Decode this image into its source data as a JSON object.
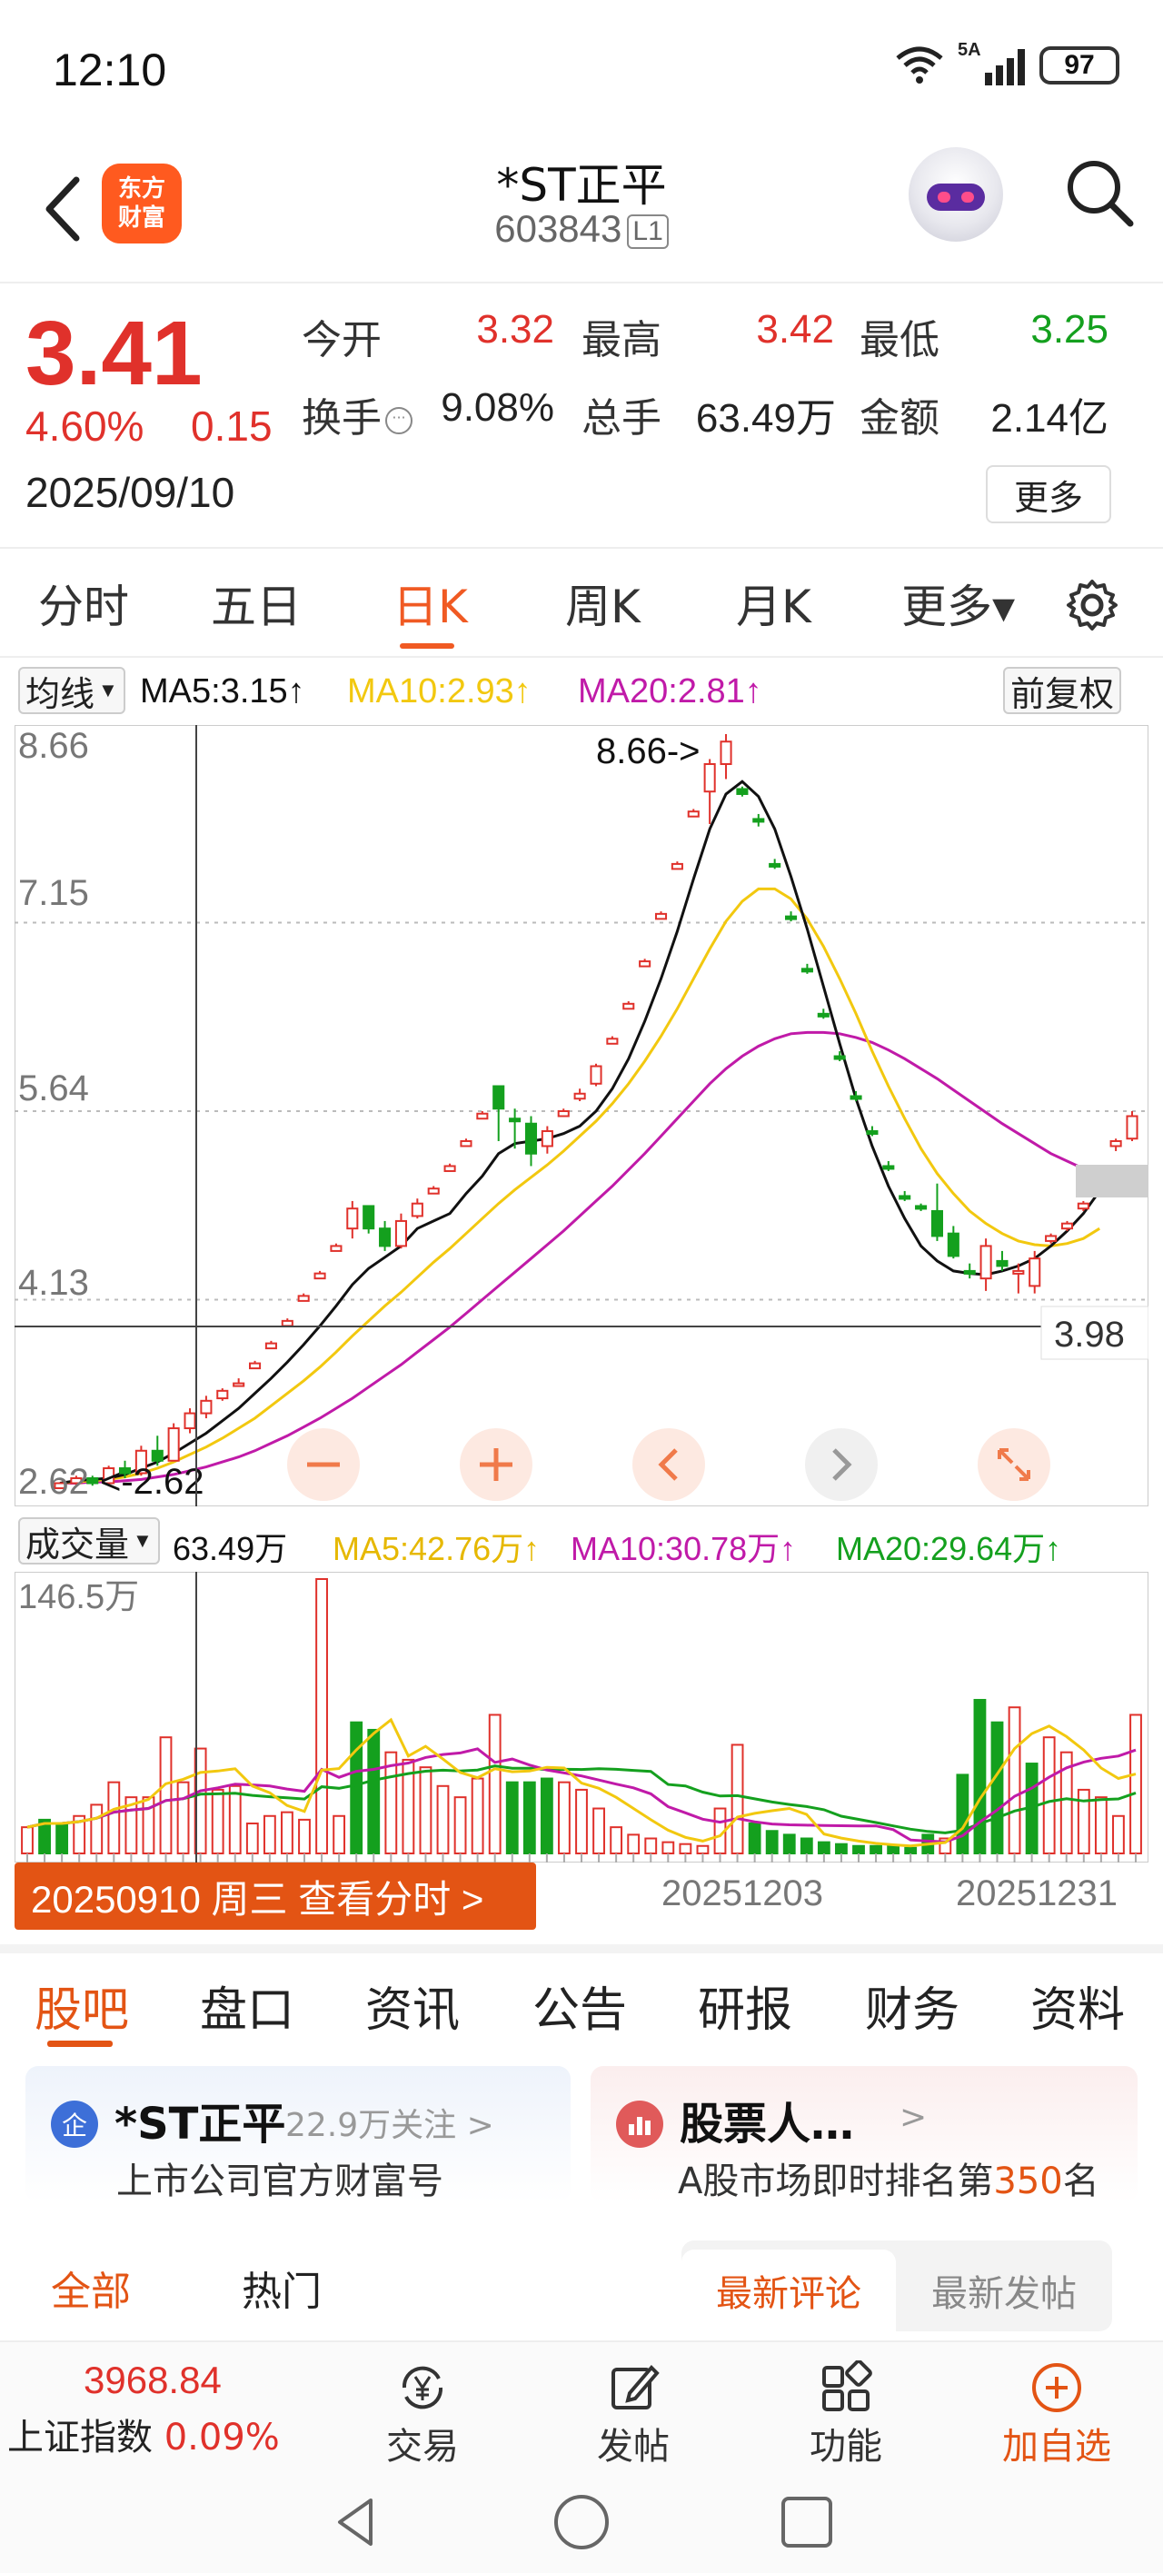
{
  "status_bar": {
    "time": "12:10",
    "network": "5A",
    "battery": "97"
  },
  "header": {
    "logo_text_line1": "东方",
    "logo_text_line2": "财富",
    "stock_name": "*ST正平",
    "stock_code": "603843",
    "market_level": "L1"
  },
  "quote": {
    "price": "3.41",
    "change_pct": "4.60%",
    "change_amt": "0.15",
    "date": "2025/09/10",
    "open_label": "今开",
    "open_value": "3.32",
    "high_label": "最高",
    "high_value": "3.42",
    "low_label": "最低",
    "low_value": "3.25",
    "turnover_label": "换手",
    "turnover_value": "9.08%",
    "volume_label": "总手",
    "volume_value": "63.49万",
    "amount_label": "金额",
    "amount_value": "2.14亿",
    "more_label": "更多"
  },
  "period_tabs": [
    {
      "label": "分时",
      "active": false
    },
    {
      "label": "五日",
      "active": false
    },
    {
      "label": "日K",
      "active": true
    },
    {
      "label": "周K",
      "active": false
    },
    {
      "label": "月K",
      "active": false
    },
    {
      "label": "更多▾",
      "active": false
    }
  ],
  "ma_legend": {
    "selector": "均线",
    "ma5": "MA5:3.15↑",
    "ma10": "MA10:2.93↑",
    "ma20": "MA20:2.81↑",
    "adjust": "前复权"
  },
  "kline": {
    "y_ticks": [
      "8.66",
      "7.15",
      "5.64",
      "4.13",
      "2.62"
    ],
    "max_label": "8.66->",
    "min_label": "<-2.62",
    "crosshair_value": "3.98",
    "controls": [
      "zoom-out",
      "zoom-in",
      "prev",
      "next",
      "fullscreen"
    ]
  },
  "volume_legend": {
    "selector": "成交量",
    "vol": "63.49万",
    "ma5": "MA5:42.76万↑",
    "ma10": "MA10:30.78万↑",
    "ma20": "MA20:29.64万↑",
    "y_max": "146.5万"
  },
  "date_badge": "20250910 周三 查看分时 >",
  "x_dates": [
    "20251203",
    "20251231"
  ],
  "content_tabs": [
    {
      "label": "股吧",
      "active": true
    },
    {
      "label": "盘口",
      "active": false
    },
    {
      "label": "资讯",
      "active": false
    },
    {
      "label": "公告",
      "active": false
    },
    {
      "label": "研报",
      "active": false
    },
    {
      "label": "财务",
      "active": false
    },
    {
      "label": "资料",
      "active": false
    }
  ],
  "cards": {
    "left": {
      "badge": "企",
      "title": "*ST正平",
      "meta": "22.9万关注 >",
      "sub": "上市公司官方财富号"
    },
    "right": {
      "title": "股票人…",
      "meta": ">",
      "sub_prefix": "A股市场即时排名第",
      "rank": "350",
      "sub_suffix": "名"
    }
  },
  "filters": {
    "all": "全部",
    "hot": "热门",
    "latest_comment": "最新评论",
    "latest_post": "最新发帖"
  },
  "bottom_bar": {
    "index_value": "3968.84",
    "index_label": "上证指数",
    "index_pct": "0.09%",
    "nav": [
      "交易",
      "发帖",
      "功能",
      "加自选"
    ]
  },
  "colors": {
    "up": "#e0312b",
    "down": "#14a01e",
    "accent": "#e35414",
    "ma5": "#111111",
    "ma10": "#f2c80f",
    "ma20": "#c01aa8"
  },
  "chart_data": {
    "type": "candlestick",
    "ylim": [
      2.62,
      8.66
    ],
    "y_ticks": [
      8.66,
      7.15,
      5.64,
      4.13,
      2.62
    ],
    "candles": [
      {
        "o": 2.62,
        "h": 2.66,
        "l": 2.62,
        "c": 2.66
      },
      {
        "o": 2.66,
        "h": 2.72,
        "l": 2.64,
        "c": 2.7
      },
      {
        "o": 2.7,
        "h": 2.72,
        "l": 2.64,
        "c": 2.66
      },
      {
        "o": 2.66,
        "h": 2.8,
        "l": 2.64,
        "c": 2.78
      },
      {
        "o": 2.78,
        "h": 2.84,
        "l": 2.7,
        "c": 2.74
      },
      {
        "o": 2.74,
        "h": 2.96,
        "l": 2.72,
        "c": 2.92
      },
      {
        "o": 2.92,
        "h": 3.04,
        "l": 2.8,
        "c": 2.84
      },
      {
        "o": 2.84,
        "h": 3.14,
        "l": 2.84,
        "c": 3.1
      },
      {
        "o": 3.1,
        "h": 3.26,
        "l": 3.06,
        "c": 3.22
      },
      {
        "o": 3.22,
        "h": 3.36,
        "l": 3.18,
        "c": 3.32
      },
      {
        "o": 3.34,
        "h": 3.42,
        "l": 3.32,
        "c": 3.4
      },
      {
        "o": 3.44,
        "h": 3.5,
        "l": 3.44,
        "c": 3.46
      },
      {
        "o": 3.58,
        "h": 3.64,
        "l": 3.58,
        "c": 3.62
      },
      {
        "o": 3.74,
        "h": 3.8,
        "l": 3.74,
        "c": 3.78
      },
      {
        "o": 3.92,
        "h": 3.98,
        "l": 3.92,
        "c": 3.96
      },
      {
        "o": 4.12,
        "h": 4.18,
        "l": 4.12,
        "c": 4.16
      },
      {
        "o": 4.3,
        "h": 4.36,
        "l": 4.3,
        "c": 4.34
      },
      {
        "o": 4.52,
        "h": 4.58,
        "l": 4.52,
        "c": 4.56
      },
      {
        "o": 4.7,
        "h": 4.92,
        "l": 4.62,
        "c": 4.86
      },
      {
        "o": 4.88,
        "h": 4.88,
        "l": 4.66,
        "c": 4.7
      },
      {
        "o": 4.7,
        "h": 4.76,
        "l": 4.52,
        "c": 4.56
      },
      {
        "o": 4.56,
        "h": 4.82,
        "l": 4.54,
        "c": 4.76
      },
      {
        "o": 4.8,
        "h": 4.94,
        "l": 4.78,
        "c": 4.9
      },
      {
        "o": 4.98,
        "h": 5.04,
        "l": 4.98,
        "c": 5.02
      },
      {
        "o": 5.16,
        "h": 5.22,
        "l": 5.16,
        "c": 5.2
      },
      {
        "o": 5.36,
        "h": 5.42,
        "l": 5.36,
        "c": 5.4
      },
      {
        "o": 5.58,
        "h": 5.64,
        "l": 5.58,
        "c": 5.62
      },
      {
        "o": 5.84,
        "h": 5.84,
        "l": 5.4,
        "c": 5.66
      },
      {
        "o": 5.58,
        "h": 5.66,
        "l": 5.34,
        "c": 5.56
      },
      {
        "o": 5.54,
        "h": 5.6,
        "l": 5.2,
        "c": 5.3
      },
      {
        "o": 5.36,
        "h": 5.52,
        "l": 5.3,
        "c": 5.48
      },
      {
        "o": 5.6,
        "h": 5.66,
        "l": 5.6,
        "c": 5.64
      },
      {
        "o": 5.74,
        "h": 5.82,
        "l": 5.72,
        "c": 5.78
      },
      {
        "o": 5.86,
        "h": 6.02,
        "l": 5.84,
        "c": 6.0
      },
      {
        "o": 6.18,
        "h": 6.24,
        "l": 6.18,
        "c": 6.22
      },
      {
        "o": 6.46,
        "h": 6.52,
        "l": 6.46,
        "c": 6.5
      },
      {
        "o": 6.8,
        "h": 6.86,
        "l": 6.8,
        "c": 6.84
      },
      {
        "o": 7.18,
        "h": 7.24,
        "l": 7.18,
        "c": 7.22
      },
      {
        "o": 7.58,
        "h": 7.64,
        "l": 7.58,
        "c": 7.62
      },
      {
        "o": 8.0,
        "h": 8.06,
        "l": 8.0,
        "c": 8.04
      },
      {
        "o": 8.2,
        "h": 8.46,
        "l": 7.94,
        "c": 8.42
      },
      {
        "o": 8.42,
        "h": 8.66,
        "l": 8.3,
        "c": 8.6
      },
      {
        "o": 8.22,
        "h": 8.24,
        "l": 8.16,
        "c": 8.18
      },
      {
        "o": 7.98,
        "h": 8.02,
        "l": 7.92,
        "c": 7.96
      },
      {
        "o": 7.62,
        "h": 7.66,
        "l": 7.58,
        "c": 7.6
      },
      {
        "o": 7.2,
        "h": 7.24,
        "l": 7.16,
        "c": 7.18
      },
      {
        "o": 6.78,
        "h": 6.82,
        "l": 6.74,
        "c": 6.76
      },
      {
        "o": 6.42,
        "h": 6.46,
        "l": 6.38,
        "c": 6.4
      },
      {
        "o": 6.08,
        "h": 6.12,
        "l": 6.04,
        "c": 6.06
      },
      {
        "o": 5.76,
        "h": 5.8,
        "l": 5.72,
        "c": 5.74
      },
      {
        "o": 5.48,
        "h": 5.52,
        "l": 5.44,
        "c": 5.46
      },
      {
        "o": 5.2,
        "h": 5.24,
        "l": 5.16,
        "c": 5.18
      },
      {
        "o": 4.96,
        "h": 5.0,
        "l": 4.92,
        "c": 4.94
      },
      {
        "o": 4.88,
        "h": 4.9,
        "l": 4.84,
        "c": 4.86
      },
      {
        "o": 4.84,
        "h": 5.06,
        "l": 4.6,
        "c": 4.64
      },
      {
        "o": 4.66,
        "h": 4.72,
        "l": 4.46,
        "c": 4.48
      },
      {
        "o": 4.36,
        "h": 4.42,
        "l": 4.3,
        "c": 4.34
      },
      {
        "o": 4.3,
        "h": 4.62,
        "l": 4.2,
        "c": 4.56
      },
      {
        "o": 4.44,
        "h": 4.52,
        "l": 4.36,
        "c": 4.4
      },
      {
        "o": 4.34,
        "h": 4.42,
        "l": 4.18,
        "c": 4.36
      },
      {
        "o": 4.24,
        "h": 4.52,
        "l": 4.18,
        "c": 4.46
      },
      {
        "o": 4.6,
        "h": 4.66,
        "l": 4.58,
        "c": 4.64
      },
      {
        "o": 4.7,
        "h": 4.76,
        "l": 4.68,
        "c": 4.74
      },
      {
        "o": 4.86,
        "h": 4.92,
        "l": 4.84,
        "c": 4.9
      },
      {
        "o": 5.08,
        "h": 5.14,
        "l": 5.06,
        "c": 5.12
      },
      {
        "o": 5.36,
        "h": 5.42,
        "l": 5.32,
        "c": 5.4
      },
      {
        "o": 5.42,
        "h": 5.64,
        "l": 5.4,
        "c": 5.6
      }
    ],
    "volumes": [
      {
        "v": 14,
        "up": true
      },
      {
        "v": 18,
        "up": false
      },
      {
        "v": 16,
        "up": false
      },
      {
        "v": 20,
        "up": true
      },
      {
        "v": 26,
        "up": true
      },
      {
        "v": 38,
        "up": true
      },
      {
        "v": 30,
        "up": true
      },
      {
        "v": 30,
        "up": true
      },
      {
        "v": 62,
        "up": true
      },
      {
        "v": 38,
        "up": true
      },
      {
        "v": 56,
        "up": true
      },
      {
        "v": 34,
        "up": true
      },
      {
        "v": 36,
        "up": true
      },
      {
        "v": 16,
        "up": true
      },
      {
        "v": 20,
        "up": true
      },
      {
        "v": 22,
        "up": true
      },
      {
        "v": 18,
        "up": true
      },
      {
        "v": 146.5,
        "up": true
      },
      {
        "v": 20,
        "up": true
      },
      {
        "v": 70,
        "up": false
      },
      {
        "v": 66,
        "up": false
      },
      {
        "v": 54,
        "up": true
      },
      {
        "v": 50,
        "up": true
      },
      {
        "v": 46,
        "up": true
      },
      {
        "v": 36,
        "up": true
      },
      {
        "v": 30,
        "up": true
      },
      {
        "v": 40,
        "up": true
      },
      {
        "v": 74,
        "up": true
      },
      {
        "v": 38,
        "up": false
      },
      {
        "v": 38,
        "up": false
      },
      {
        "v": 40,
        "up": false
      },
      {
        "v": 38,
        "up": true
      },
      {
        "v": 34,
        "up": true
      },
      {
        "v": 24,
        "up": true
      },
      {
        "v": 14,
        "up": true
      },
      {
        "v": 10,
        "up": true
      },
      {
        "v": 8,
        "up": true
      },
      {
        "v": 6,
        "up": true
      },
      {
        "v": 5,
        "up": true
      },
      {
        "v": 4,
        "up": true
      },
      {
        "v": 24,
        "up": true
      },
      {
        "v": 58,
        "up": true
      },
      {
        "v": 16,
        "up": false
      },
      {
        "v": 12,
        "up": false
      },
      {
        "v": 10,
        "up": false
      },
      {
        "v": 8,
        "up": false
      },
      {
        "v": 6,
        "up": false
      },
      {
        "v": 5,
        "up": false
      },
      {
        "v": 4,
        "up": false
      },
      {
        "v": 4,
        "up": false
      },
      {
        "v": 4,
        "up": false
      },
      {
        "v": 3,
        "up": false
      },
      {
        "v": 10,
        "up": false
      },
      {
        "v": 8,
        "up": true
      },
      {
        "v": 42,
        "up": false
      },
      {
        "v": 82,
        "up": false
      },
      {
        "v": 70,
        "up": false
      },
      {
        "v": 78,
        "up": true
      },
      {
        "v": 48,
        "up": false
      },
      {
        "v": 62,
        "up": true
      },
      {
        "v": 54,
        "up": true
      },
      {
        "v": 34,
        "up": true
      },
      {
        "v": 30,
        "up": true
      },
      {
        "v": 20,
        "up": true
      },
      {
        "v": 74,
        "up": true
      }
    ],
    "ma5": [
      2.66,
      2.68,
      2.69,
      2.7,
      2.73,
      2.78,
      2.83,
      2.9,
      2.98,
      3.06,
      3.16,
      3.26,
      3.38,
      3.5,
      3.63,
      3.77,
      3.92,
      4.08,
      4.25,
      4.38,
      4.47,
      4.56,
      4.7,
      4.76,
      4.82,
      4.98,
      5.12,
      5.3,
      5.38,
      5.4,
      5.42,
      5.46,
      5.52,
      5.64,
      5.82,
      6.06,
      6.36,
      6.7,
      7.08,
      7.5,
      7.9,
      8.18,
      8.28,
      8.16,
      7.9,
      7.52,
      7.1,
      6.64,
      6.18,
      5.74,
      5.36,
      5.04,
      4.78,
      4.56,
      4.44,
      4.36,
      4.34,
      4.33,
      4.36,
      4.4,
      4.46,
      4.56,
      4.68,
      4.82,
      5.0
    ],
    "ma10": [
      2.66,
      2.67,
      2.68,
      2.69,
      2.71,
      2.74,
      2.78,
      2.83,
      2.89,
      2.95,
      3.02,
      3.1,
      3.18,
      3.28,
      3.38,
      3.48,
      3.59,
      3.71,
      3.84,
      3.96,
      4.08,
      4.19,
      4.31,
      4.43,
      4.54,
      4.66,
      4.78,
      4.9,
      5.01,
      5.11,
      5.21,
      5.32,
      5.44,
      5.56,
      5.7,
      5.86,
      6.04,
      6.24,
      6.46,
      6.7,
      6.94,
      7.16,
      7.32,
      7.42,
      7.42,
      7.34,
      7.18,
      6.96,
      6.7,
      6.42,
      6.12,
      5.84,
      5.58,
      5.34,
      5.14,
      4.98,
      4.84,
      4.74,
      4.66,
      4.6,
      4.57,
      4.56,
      4.58,
      4.62,
      4.7
    ],
    "ma20": [
      2.66,
      2.66,
      2.67,
      2.67,
      2.68,
      2.69,
      2.71,
      2.73,
      2.76,
      2.79,
      2.83,
      2.87,
      2.92,
      2.98,
      3.04,
      3.11,
      3.18,
      3.26,
      3.34,
      3.43,
      3.52,
      3.61,
      3.71,
      3.81,
      3.91,
      4.02,
      4.13,
      4.24,
      4.35,
      4.46,
      4.57,
      4.68,
      4.8,
      4.92,
      5.04,
      5.17,
      5.3,
      5.44,
      5.58,
      5.72,
      5.86,
      5.98,
      6.08,
      6.16,
      6.22,
      6.26,
      6.27,
      6.27,
      6.26,
      6.23,
      6.19,
      6.13,
      6.06,
      5.98,
      5.9,
      5.81,
      5.72,
      5.63,
      5.54,
      5.46,
      5.38,
      5.3,
      5.24,
      5.18,
      5.12
    ]
  }
}
